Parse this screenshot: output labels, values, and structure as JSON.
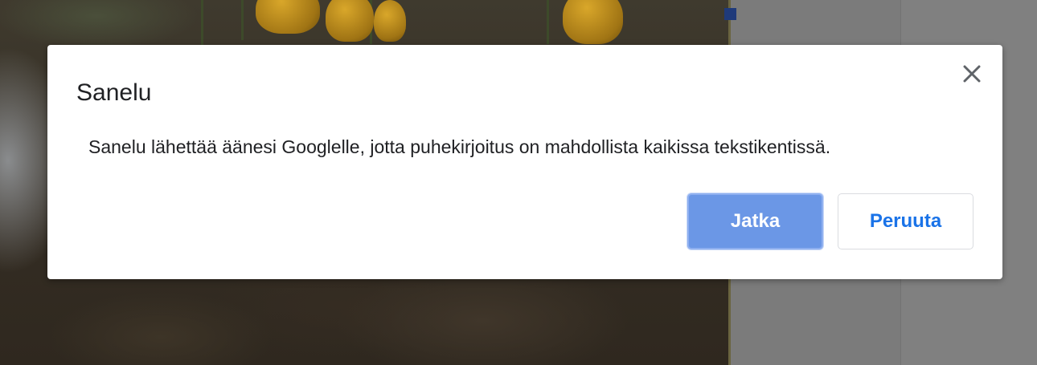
{
  "dialog": {
    "title": "Sanelu",
    "message": "Sanelu lähettää äänesi Googlelle, jotta puhekirjoitus on mahdollista kaikissa tekstikentissä.",
    "close_icon": "close-icon",
    "primary_button": "Jatka",
    "secondary_button": "Peruuta"
  },
  "colors": {
    "primary_button_bg": "#6b97e6",
    "secondary_button_text": "#1a73e8",
    "handle": "#1f3a7a"
  }
}
